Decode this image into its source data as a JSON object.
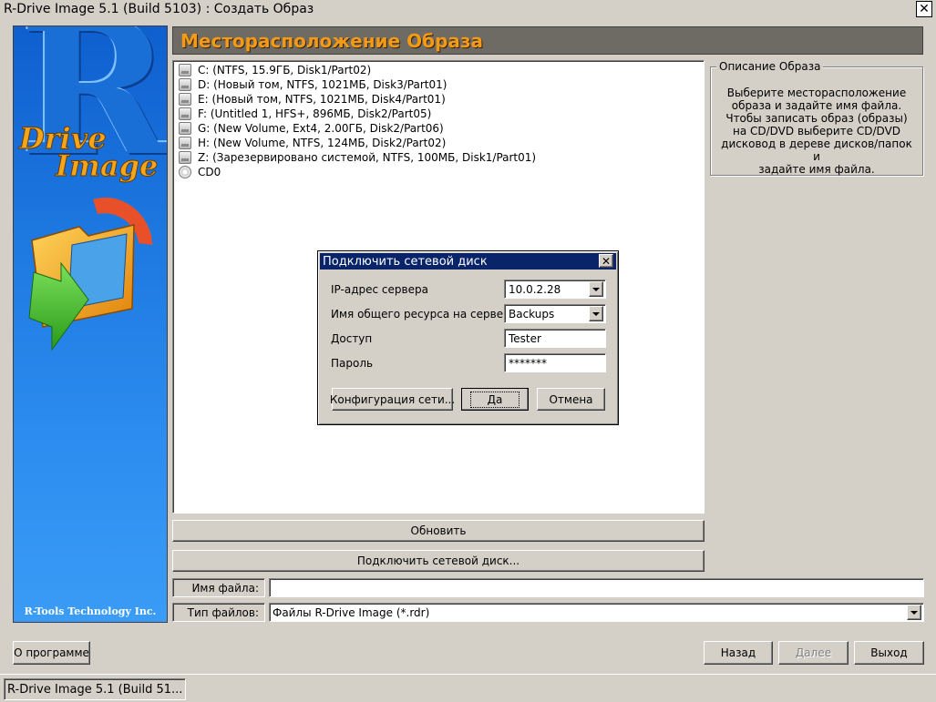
{
  "window": {
    "title": "R-Drive Image 5.1 (Build 5103) : Создать Образ",
    "close_glyph": "✕"
  },
  "brand": {
    "letter": "R",
    "drive_text": "Drive",
    "image_text": "Image",
    "company": "R-Tools Technology Inc.",
    "primary_color": "#1d78e0",
    "accent_color": "#f3a51c"
  },
  "header": {
    "title": "Месторасположение Образа",
    "title_color": "#f39a16"
  },
  "tree": {
    "items": [
      {
        "label": "C: (NTFS, 15.9ГБ, Disk1/Part02)",
        "icon": "drive-icon"
      },
      {
        "label": "D: (Новый том, NTFS, 1021МБ, Disk3/Part01)",
        "icon": "drive-icon"
      },
      {
        "label": "E: (Новый том, NTFS, 1021МБ, Disk4/Part01)",
        "icon": "drive-icon"
      },
      {
        "label": "F: (Untitled 1, HFS+, 896МБ, Disk2/Part05)",
        "icon": "drive-icon"
      },
      {
        "label": "G: (New Volume, Ext4, 2.00ГБ, Disk2/Part06)",
        "icon": "drive-icon"
      },
      {
        "label": "H: (New Volume, NTFS, 124МБ, Disk2/Part02)",
        "icon": "drive-icon"
      },
      {
        "label": "Z: (Зарезервировано системой, NTFS, 100МБ, Disk1/Part01)",
        "icon": "drive-icon"
      },
      {
        "label": "CD0",
        "icon": "cd-icon"
      }
    ]
  },
  "description": {
    "legend": "Описание Образа",
    "text": "Выберите месторасположение\nобраза и задайте имя файла.\nЧтобы записать образ (образы)\nна CD/DVD выберите CD/DVD\nдисковод в дереве дисков/папок и\nзадайте имя файла."
  },
  "buttons": {
    "refresh": "Обновить",
    "connect_network": "Подключить сетевой диск...",
    "about": "О программе",
    "back": "Назад",
    "next": "Далее",
    "exit": "Выход"
  },
  "file": {
    "name_label": "Имя файла:",
    "name_value": "",
    "type_label": "Тип файлов:",
    "type_value": "Файлы R-Drive Image (*.rdr)"
  },
  "dialog": {
    "title": "Подключить сетевой диск",
    "close_glyph": "✕",
    "server_ip_label": "IP-адрес сервера",
    "server_ip_value": "10.0.2.28",
    "share_label": "Имя общего ресурса на сервере",
    "share_value": "Backups",
    "login_label": "Доступ",
    "login_value": "Tester",
    "password_label": "Пароль",
    "password_value": "*******",
    "network_config_button": "Конфигурация сети...",
    "ok_button": "Да",
    "cancel_button": "Отмена"
  },
  "taskbar": {
    "item_label": "R-Drive Image 5.1 (Build 51..."
  }
}
